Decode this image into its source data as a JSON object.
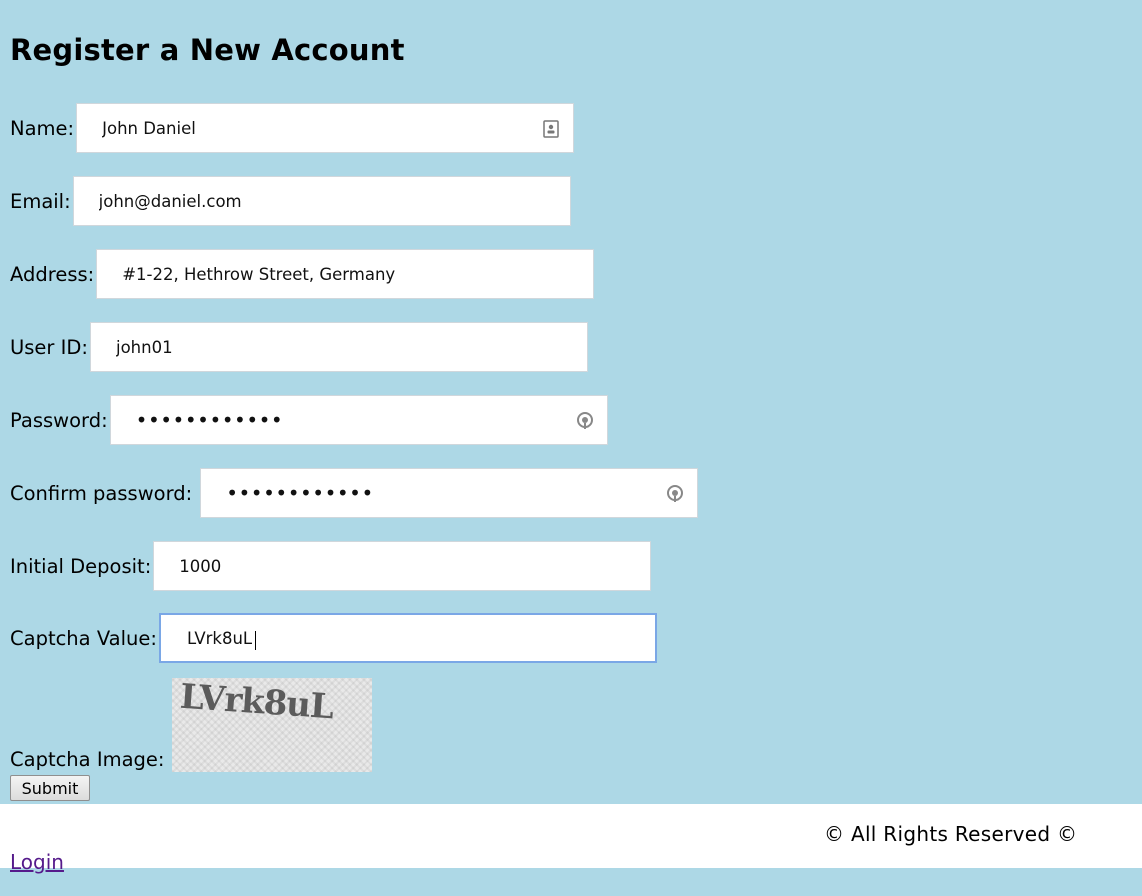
{
  "page": {
    "title": "Register a New Account"
  },
  "form": {
    "name": {
      "label": "Name:",
      "value": "John Daniel",
      "icon": "contact-card-icon"
    },
    "email": {
      "label": "Email:",
      "value": "john@daniel.com"
    },
    "address": {
      "label": "Address:",
      "value": "#1-22, Hethrow Street, Germany"
    },
    "user_id": {
      "label": "User ID:",
      "value": "john01"
    },
    "password": {
      "label": "Password:",
      "value": "••••••••••••",
      "icon": "key-icon"
    },
    "confirm_password": {
      "label": "Confirm password:",
      "value": "••••••••••••",
      "icon": "key-icon"
    },
    "initial_deposit": {
      "label": "Initial Deposit:",
      "value": "1000"
    },
    "captcha_value": {
      "label": "Captcha Value:",
      "value": "LVrk8uL"
    },
    "captcha_image": {
      "label": "Captcha Image:",
      "text": "LVrk8uL"
    },
    "submit_label": "Submit"
  },
  "footer": {
    "copyright": "© All Rights Reserved ©",
    "login_label": "Login"
  },
  "colors": {
    "background": "#add8e6",
    "footer_band": "#ffffff",
    "focus_border": "#7aa7e6",
    "link": "#551a8b"
  }
}
